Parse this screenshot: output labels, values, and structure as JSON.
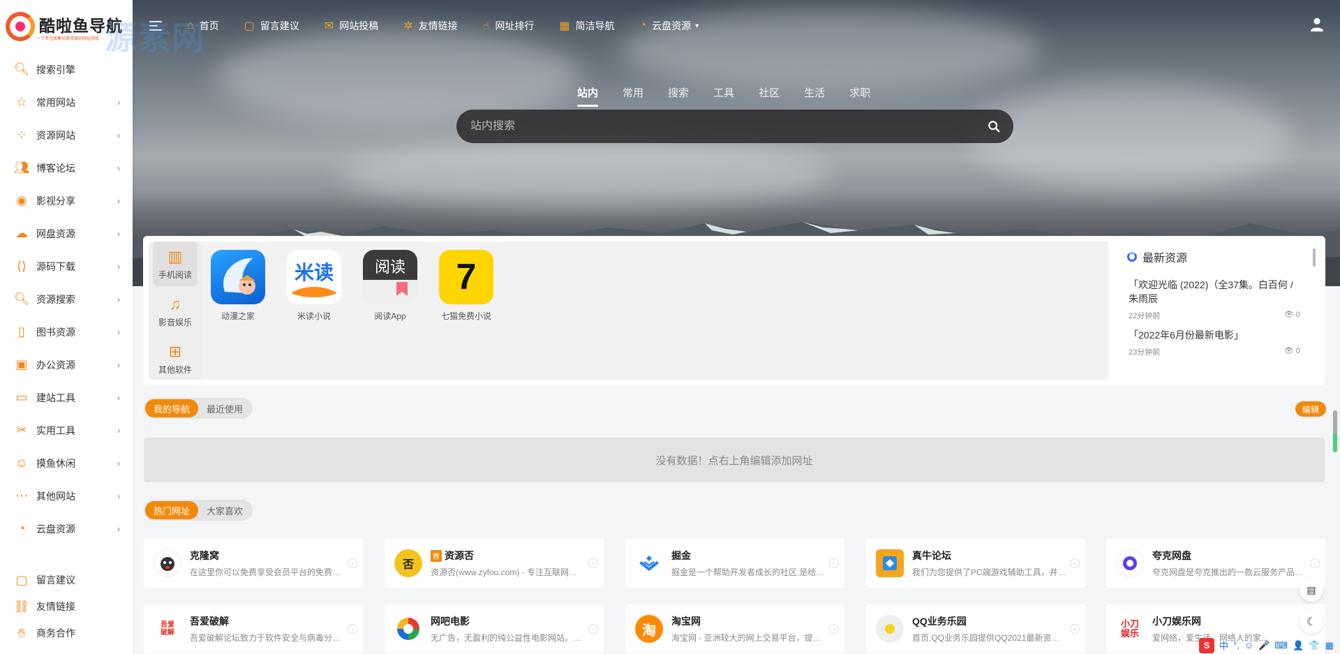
{
  "brand": {
    "logo_text": "酷啦鱼导航",
    "logo_sub": "一个专注收集优质资源的网址导航",
    "watermark": "源素网"
  },
  "topnav": {
    "items": [
      {
        "label": "首页",
        "icon": "home-icon"
      },
      {
        "label": "留言建议",
        "icon": "message-icon"
      },
      {
        "label": "网站投稿",
        "icon": "send-icon"
      },
      {
        "label": "友情链接",
        "icon": "link-icon"
      },
      {
        "label": "网址排行",
        "icon": "thumb-icon"
      },
      {
        "label": "简洁导航",
        "icon": "calendar-icon"
      },
      {
        "label": "云盘资源",
        "icon": "cloud-icon"
      }
    ]
  },
  "sidebar": {
    "items": [
      {
        "label": "搜索引擎",
        "icon": "search-icon"
      },
      {
        "label": "常用网站",
        "icon": "star-icon"
      },
      {
        "label": "资源网站",
        "icon": "grid-icon"
      },
      {
        "label": "博客论坛",
        "icon": "users-icon"
      },
      {
        "label": "影视分享",
        "icon": "film-icon"
      },
      {
        "label": "网盘资源",
        "icon": "cloud-icon"
      },
      {
        "label": "源码下载",
        "icon": "code-icon"
      },
      {
        "label": "资源搜索",
        "icon": "search-icon"
      },
      {
        "label": "图书资源",
        "icon": "book-icon"
      },
      {
        "label": "办公资源",
        "icon": "briefcase-icon"
      },
      {
        "label": "建站工具",
        "icon": "monitor-icon"
      },
      {
        "label": "实用工具",
        "icon": "tools-icon"
      },
      {
        "label": "摸鱼休闲",
        "icon": "fish-icon"
      },
      {
        "label": "其他网站",
        "icon": "more-icon"
      },
      {
        "label": "云盘资源",
        "icon": "cloud-drive-icon"
      }
    ],
    "bottom_items": [
      {
        "label": "留言建议",
        "icon": "message-icon"
      },
      {
        "label": "友情链接",
        "icon": "link-icon"
      },
      {
        "label": "商务合作",
        "icon": "handshake-icon"
      }
    ]
  },
  "search": {
    "tabs": [
      "站内",
      "常用",
      "搜索",
      "工具",
      "社区",
      "生活",
      "求职"
    ],
    "active_tab": "站内",
    "placeholder": "站内搜索"
  },
  "app_panel": {
    "categories": [
      {
        "label": "手机阅读",
        "icon": "book-open-icon"
      },
      {
        "label": "影音娱乐",
        "icon": "music-icon"
      },
      {
        "label": "其他软件",
        "icon": "apps-icon"
      }
    ],
    "apps": [
      {
        "name": "动漫之家"
      },
      {
        "name": "米读小说",
        "icon_text": "米读"
      },
      {
        "name": "阅读App",
        "icon_text": "阅读"
      },
      {
        "name": "七猫免费小说",
        "icon_text": "7"
      }
    ]
  },
  "resources": {
    "title": "最新资源",
    "items": [
      {
        "title": "「欢迎光临 (2022)（全37集。白百何 / 朱雨辰",
        "time": "22分钟前",
        "views": "0"
      },
      {
        "title": "「2022年6月份最新电影」",
        "time": "23分钟前",
        "views": "0"
      }
    ]
  },
  "my_nav": {
    "tabs": [
      "我的导航",
      "最近使用"
    ],
    "edit_label": "编辑",
    "empty_text": "没有数据！点右上角编辑添加网址"
  },
  "hot": {
    "tabs": [
      "热门网址",
      "大家喜欢"
    ],
    "sites": [
      {
        "name": "克隆窝",
        "desc": "在这里你可以免费享受会员平台的免费资...",
        "color": "#ffffff",
        "icon_text": ""
      },
      {
        "name": "资源否",
        "tag": "荐",
        "desc": "资源否(www.zyfou.com) - 专注互联网分享...",
        "color": "#f5c41a",
        "icon_text": "否"
      },
      {
        "name": "掘金",
        "desc": "掘金是一个帮助开发者成长的社区,是给开...",
        "color": "#ffffff",
        "icon_text": ""
      },
      {
        "name": "真牛论坛",
        "desc": "我们为您提供了PC端游戏辅助工具，并且...",
        "color": "#f7a51c",
        "icon_text": ""
      },
      {
        "name": "夸克网盘",
        "desc": "夸克网盘是夸克推出的一款云服务产品，...",
        "color": "#ffffff",
        "icon_text": ""
      },
      {
        "name": "吾爱破解",
        "desc": "吾爱破解论坛致力于软件安全与病毒分析...",
        "color": "#ffffff",
        "icon_text": "吾爱破解"
      },
      {
        "name": "网吧电影",
        "desc": "无广告，无盈利的纯公益性电影网站。爱...",
        "color": "#ffffff",
        "icon_text": ""
      },
      {
        "name": "淘宝网",
        "desc": "淘宝网 - 亚洲较大的网上交易平台，提供...",
        "color": "#ff8a00",
        "icon_text": "淘"
      },
      {
        "name": "QQ业务乐园",
        "desc": "首页,QQ业务乐园提供QQ2021最新资讯,...",
        "color": "#eeeeee",
        "icon_text": ""
      },
      {
        "name": "小刀娱乐网",
        "desc": "爱网络，爱生活，网络人的家...",
        "color": "#ffffff",
        "icon_text": "小刀娱乐"
      }
    ]
  },
  "ime": [
    "中",
    "°,",
    "☺",
    "🎤",
    "⌨",
    "👤",
    "👕",
    "▦"
  ]
}
